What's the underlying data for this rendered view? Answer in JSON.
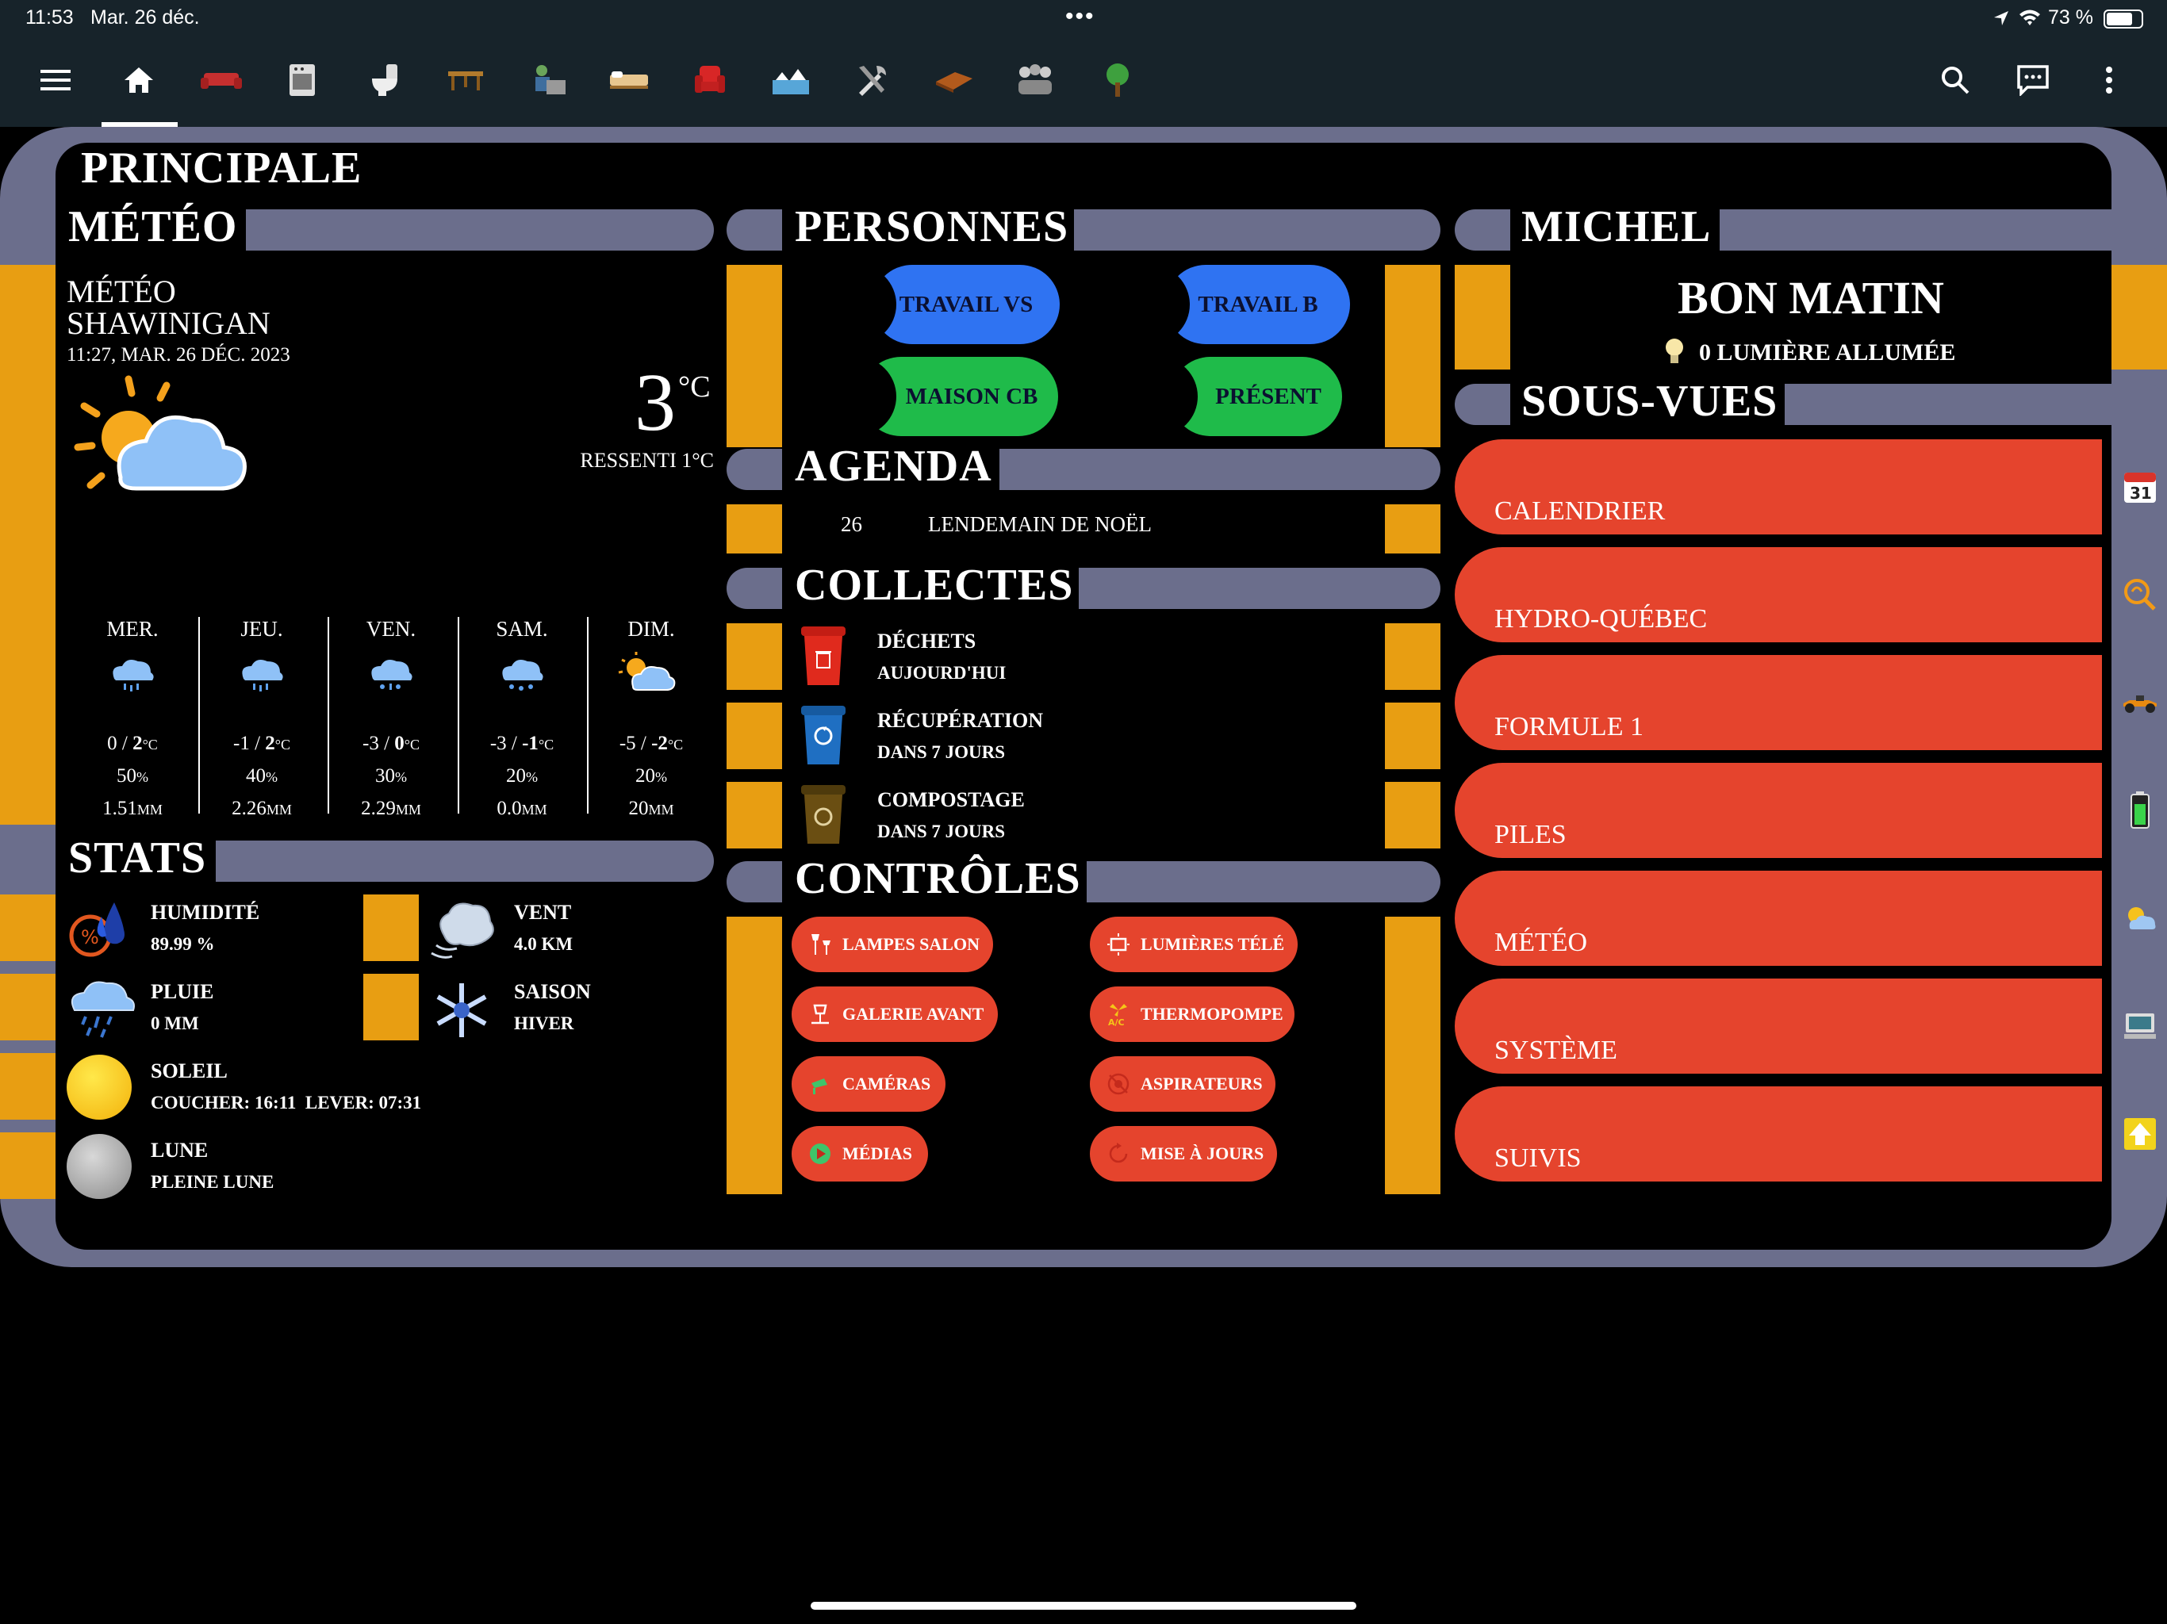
{
  "status_bar": {
    "time": "11:53",
    "date": "Mar. 26 déc.",
    "battery": "73 %",
    "dots": "•••"
  },
  "toolbar": {
    "icons": [
      "menu-icon",
      "home-icon",
      "sofa-icon",
      "kitchen-icon",
      "bathroom-icon",
      "table-icon",
      "office-icon",
      "bed-icon",
      "armchair-icon",
      "outdoor-icon",
      "tools-icon",
      "floor-icon",
      "people-icon",
      "tree-icon"
    ],
    "right_icons": [
      "search-icon",
      "chat-icon",
      "more-icon"
    ]
  },
  "page": {
    "title": "PRINCIPALE"
  },
  "meteo": {
    "title": "MÉTÉO",
    "location_line1": "MÉTÉO",
    "location_line2": "SHAWINIGAN",
    "updated": "11:27, MAR. 26 DÉC. 2023",
    "temp": "3",
    "temp_unit": "°C",
    "feels": "RESSENTI 1°C",
    "forecast": [
      {
        "day": "MER.",
        "low": "0",
        "high": "2",
        "unit": "°C",
        "precip_pct": "50",
        "precip_mm": "1.51",
        "icon": "rain-cloud-icon"
      },
      {
        "day": "JEU.",
        "low": "-1",
        "high": "2",
        "unit": "°C",
        "precip_pct": "40",
        "precip_mm": "2.26",
        "icon": "rain-cloud-icon"
      },
      {
        "day": "VEN.",
        "low": "-3",
        "high": "0",
        "unit": "°C",
        "precip_pct": "30",
        "precip_mm": "2.29",
        "icon": "rain-snow-cloud-icon"
      },
      {
        "day": "SAM.",
        "low": "-3",
        "high": "-1",
        "unit": "°C",
        "precip_pct": "20",
        "precip_mm": "0.0",
        "icon": "snow-cloud-icon"
      },
      {
        "day": "DIM.",
        "low": "-5",
        "high": "-2",
        "unit": "°C",
        "precip_pct": "20",
        "precip_mm": "20",
        "icon": "partly-cloudy-icon"
      }
    ],
    "pct_unit": "%",
    "mm_unit": "MM"
  },
  "stats": {
    "title": "STATS",
    "humidity_label": "HUMIDITÉ",
    "humidity_value": "89.99 %",
    "wind_label": "VENT",
    "wind_value": "4.0 KM",
    "rain_label": "PLUIE",
    "rain_value": "0 MM",
    "season_label": "SAISON",
    "season_value": "HIVER",
    "sun_label": "SOLEIL",
    "sun_value": "COUCHER: 16:11  LEVER: 07:31",
    "moon_label": "LUNE",
    "moon_value": "PLEINE LUNE"
  },
  "personnes": {
    "title": "PERSONNES",
    "items": [
      {
        "label": "TRAVAIL VS",
        "color": "#2f73f2"
      },
      {
        "label": "TRAVAIL B",
        "color": "#2f73f2"
      },
      {
        "label": "MAISON CB",
        "color": "#1fbb4a"
      },
      {
        "label": "PRÉSENT",
        "color": "#1fbb4a"
      }
    ]
  },
  "agenda": {
    "title": "AGENDA",
    "day": "26",
    "event": "LENDEMAIN DE NOËL"
  },
  "collectes": {
    "title": "COLLECTES",
    "items": [
      {
        "label": "DÉCHETS",
        "when": "AUJOURD'HUI",
        "color": "#e02a1d"
      },
      {
        "label": "RÉCUPÉRATION",
        "when": "DANS 7 JOURS",
        "color": "#1f6fc2"
      },
      {
        "label": "COMPOSTAGE",
        "when": "DANS 7 JOURS",
        "color": "#6a4e12"
      }
    ]
  },
  "controles": {
    "title": "CONTRÔLES",
    "buttons": [
      "LAMPES SALON",
      "LUMIÈRES TÉLÉ",
      "GALERIE AVANT",
      "THERMOPOMPE",
      "CAMÉRAS",
      "ASPIRATEURS",
      "MÉDIAS",
      "MISE À JOURS"
    ]
  },
  "michel": {
    "title": "MICHEL",
    "greeting": "BON MATIN",
    "lights": "0 LUMIÈRE ALLUMÉE"
  },
  "sous_vues": {
    "title": "SOUS-VUES",
    "items": [
      {
        "label": "CALENDRIER",
        "icon": "calendar-icon"
      },
      {
        "label": "HYDRO-QUÉBEC",
        "icon": "power-meter-icon"
      },
      {
        "label": "FORMULE 1",
        "icon": "race-car-icon"
      },
      {
        "label": "PILES",
        "icon": "battery-icon"
      },
      {
        "label": "MÉTÉO",
        "icon": "weather-icon"
      },
      {
        "label": "SYSTÈME",
        "icon": "computer-icon"
      },
      {
        "label": "SUIVIS",
        "icon": "arrow-up-icon"
      }
    ],
    "calendar_num": "31"
  },
  "colors": {
    "orange": "#e89e12",
    "gray": "#6b6e8c",
    "red": "#e5442d",
    "toolbar": "#17232a"
  }
}
